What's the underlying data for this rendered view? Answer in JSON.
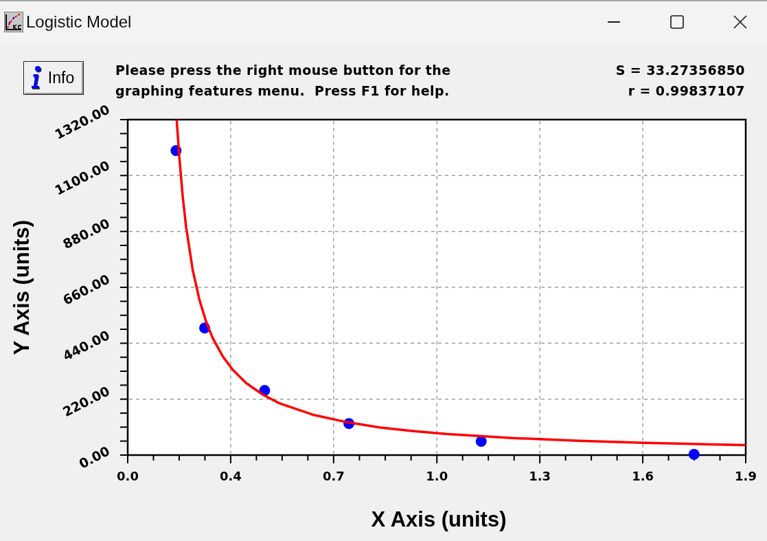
{
  "window": {
    "title": "Logistic Model"
  },
  "toolbar": {
    "info_button": {
      "label": "Info"
    },
    "message": "Please press the right mouse button for the\ngraphing features menu.  Press F1 for help.",
    "statistics": [
      "S = 33.27356850",
      "r = 0.99837107"
    ]
  },
  "chart": {
    "chart_data": {
      "type": "scatter",
      "xlabel": "X Axis (units)",
      "ylabel": "Y Axis (units)",
      "xlim": [
        0.045,
        1.9
      ],
      "ylim": [
        0,
        1320
      ],
      "grid": true,
      "xticks": [
        {
          "value": 0.045,
          "label": "0.0"
        },
        {
          "value": 0.354,
          "label": "0.4"
        },
        {
          "value": 0.663,
          "label": "0.7"
        },
        {
          "value": 0.973,
          "label": "1.0"
        },
        {
          "value": 1.282,
          "label": "1.3"
        },
        {
          "value": 1.591,
          "label": "1.6"
        },
        {
          "value": 1.9,
          "label": "1.9"
        }
      ],
      "yticks": [
        {
          "value": 0,
          "label": "0.00"
        },
        {
          "value": 220,
          "label": "220.00"
        },
        {
          "value": 440,
          "label": "440.00"
        },
        {
          "value": 660,
          "label": "660.00"
        },
        {
          "value": 880,
          "label": "880.00"
        },
        {
          "value": 1100,
          "label": "1100.00"
        },
        {
          "value": 1320,
          "label": "1320.00"
        }
      ],
      "series": [
        {
          "type": "scatter",
          "color": "#0000ff",
          "x": [
            0.19,
            0.276,
            0.456,
            0.709,
            1.106,
            1.745
          ],
          "values": [
            1198,
            500,
            254,
            124,
            54,
            3
          ]
        },
        {
          "type": "line",
          "color": "#ff0000",
          "x": [
            0.192,
            0.2,
            0.21,
            0.22,
            0.24,
            0.26,
            0.28,
            0.3,
            0.33,
            0.36,
            0.4,
            0.45,
            0.5,
            0.6,
            0.7,
            0.8,
            0.9,
            1.0,
            1.2,
            1.4,
            1.6,
            1.8,
            1.9
          ],
          "values": [
            1320,
            1171,
            1018,
            900,
            729,
            612,
            526,
            461,
            389,
            336,
            284,
            238,
            204,
            159,
            130,
            109,
            95,
            83,
            67,
            56,
            48,
            42,
            39
          ]
        }
      ]
    }
  }
}
